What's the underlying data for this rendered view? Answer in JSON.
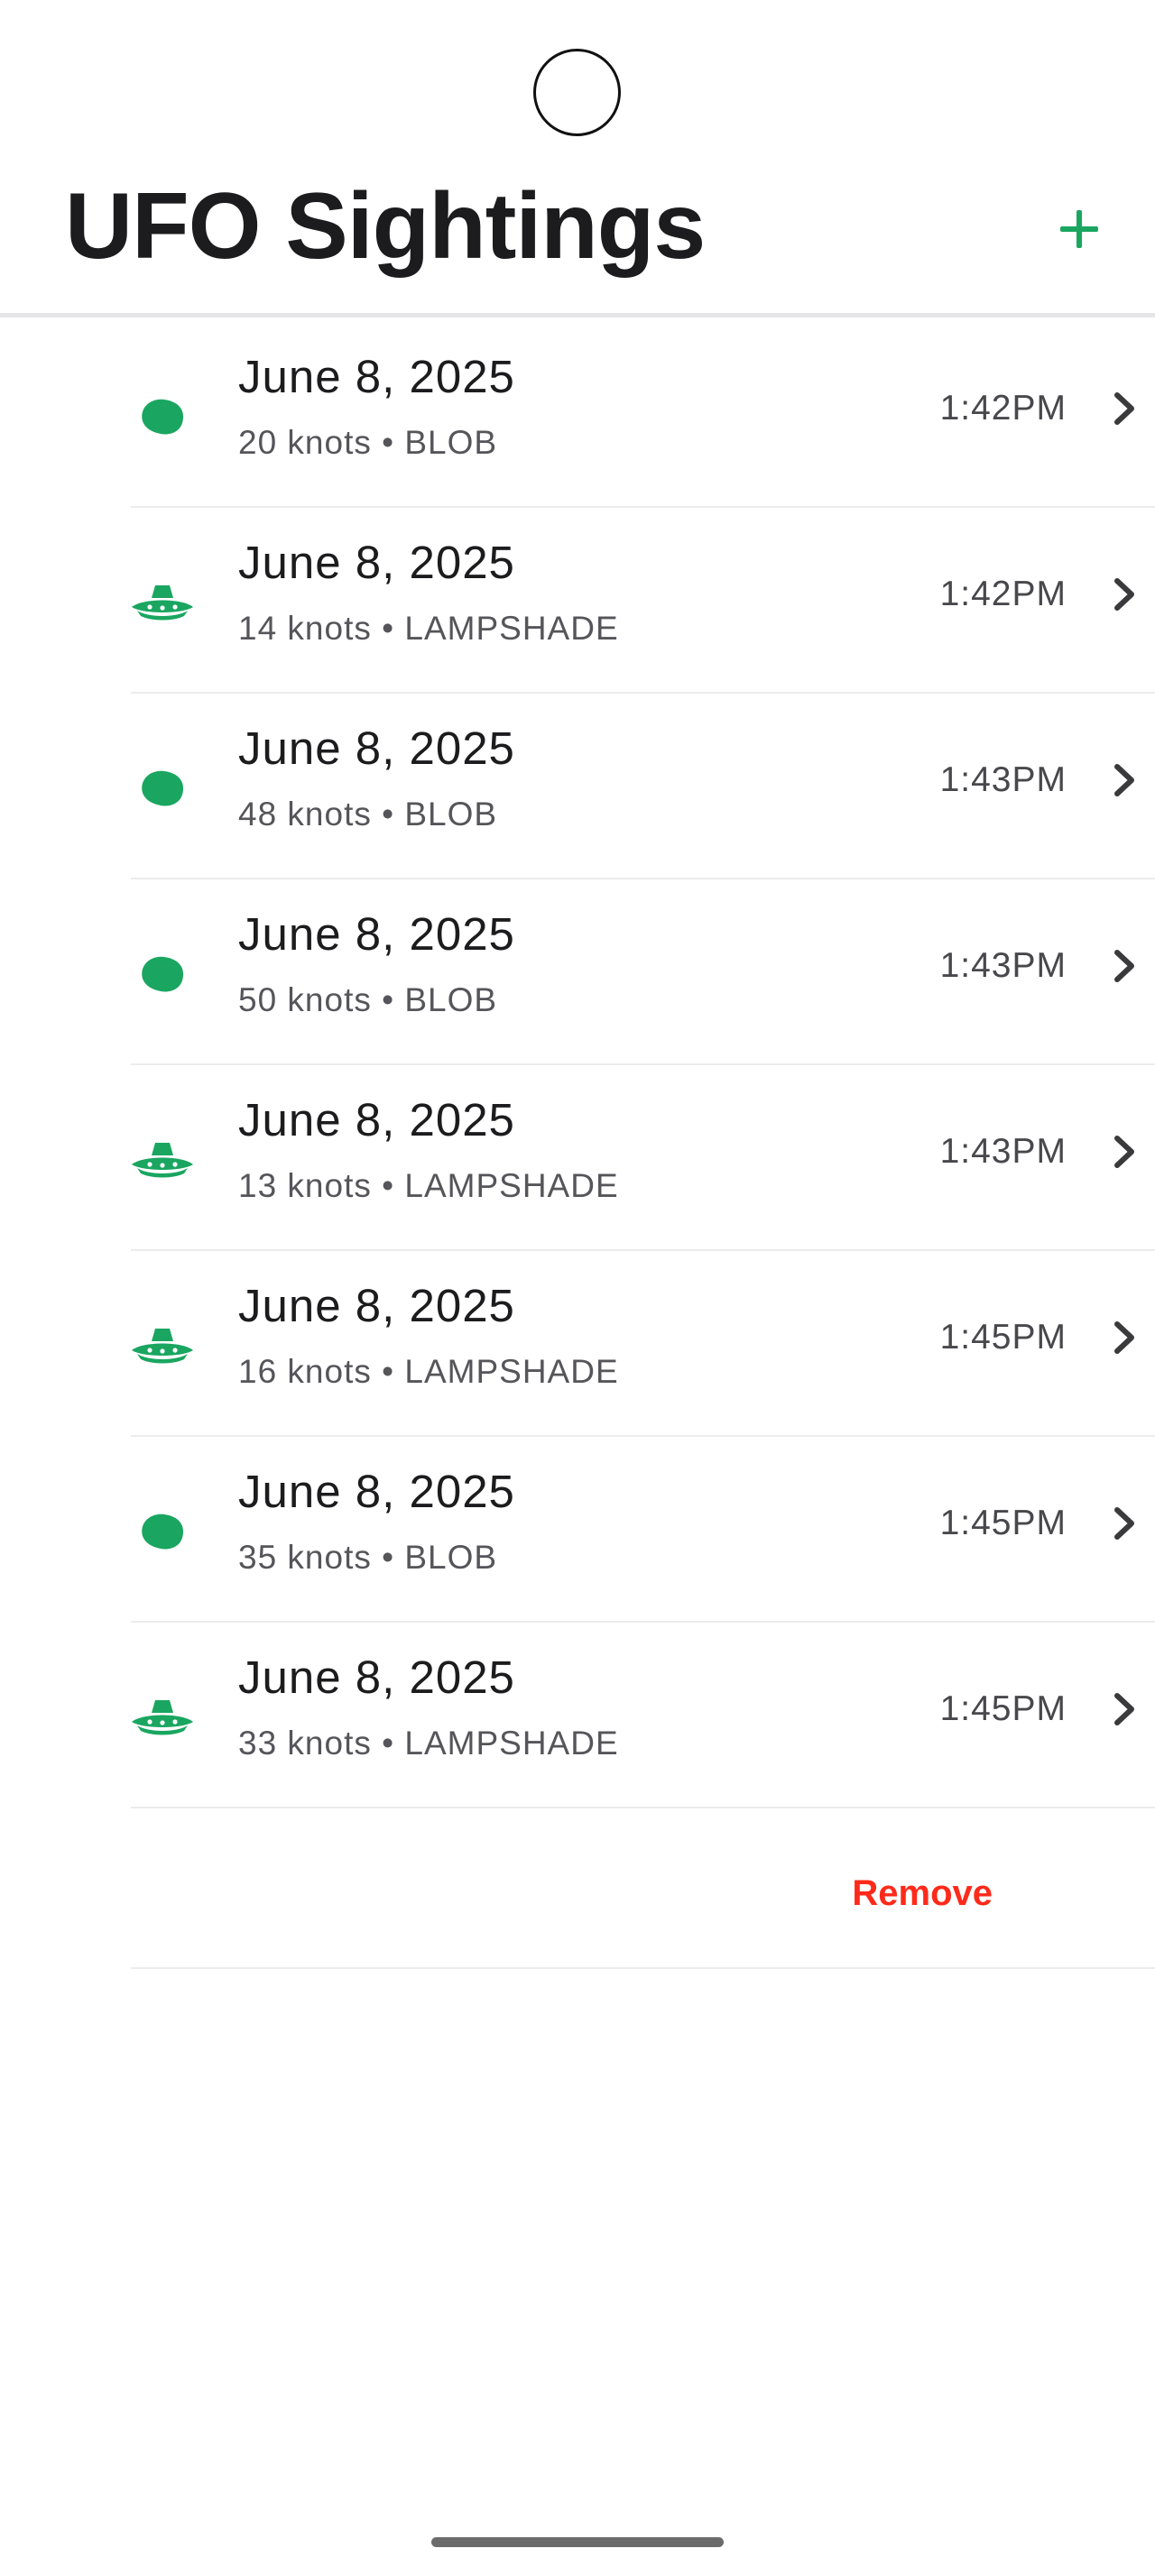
{
  "header": {
    "title": "UFO Sightings",
    "add_icon": "plus-icon"
  },
  "colors": {
    "accent": "#1aa660",
    "destructive": "#ff2a1a",
    "title": "#1c1c1e"
  },
  "sightings": [
    {
      "date": "June 8, 2025",
      "detail": "20 knots • BLOB",
      "time": "1:42PM",
      "shape": "blob"
    },
    {
      "date": "June 8, 2025",
      "detail": "14 knots • LAMPSHADE",
      "time": "1:42PM",
      "shape": "lampshade"
    },
    {
      "date": "June 8, 2025",
      "detail": "48 knots • BLOB",
      "time": "1:43PM",
      "shape": "blob"
    },
    {
      "date": "June 8, 2025",
      "detail": "50 knots • BLOB",
      "time": "1:43PM",
      "shape": "blob"
    },
    {
      "date": "June 8, 2025",
      "detail": "13 knots • LAMPSHADE",
      "time": "1:43PM",
      "shape": "lampshade"
    },
    {
      "date": "June 8, 2025",
      "detail": "16 knots • LAMPSHADE",
      "time": "1:45PM",
      "shape": "lampshade"
    },
    {
      "date": "June 8, 2025",
      "detail": "35 knots • BLOB",
      "time": "1:45PM",
      "shape": "blob"
    },
    {
      "date": "June 8, 2025",
      "detail": "33 knots • LAMPSHADE",
      "time": "1:45PM",
      "shape": "lampshade"
    }
  ],
  "actions": {
    "remove_label": "Remove"
  }
}
